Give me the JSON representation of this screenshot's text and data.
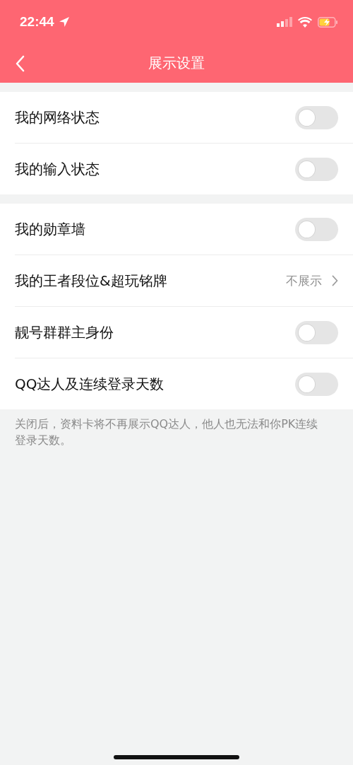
{
  "status_bar": {
    "time": "22:44"
  },
  "nav_bar": {
    "title": "展示设置"
  },
  "groups": [
    {
      "rows": [
        {
          "kind": "toggle",
          "label": "我的网络状态",
          "on": false
        },
        {
          "kind": "toggle",
          "label": "我的输入状态",
          "on": false
        }
      ]
    },
    {
      "rows": [
        {
          "kind": "toggle",
          "label": "我的勋章墙",
          "on": false
        },
        {
          "kind": "link",
          "label": "我的王者段位&超玩铭牌",
          "value": "不展示"
        },
        {
          "kind": "toggle",
          "label": "靓号群群主身份",
          "on": false
        },
        {
          "kind": "toggle",
          "label": "QQ达人及连续登录天数",
          "on": false
        }
      ]
    }
  ],
  "footnote": "关闭后，资料卡将不再展示QQ达人，他人也无法和你PK连续登录天数。"
}
